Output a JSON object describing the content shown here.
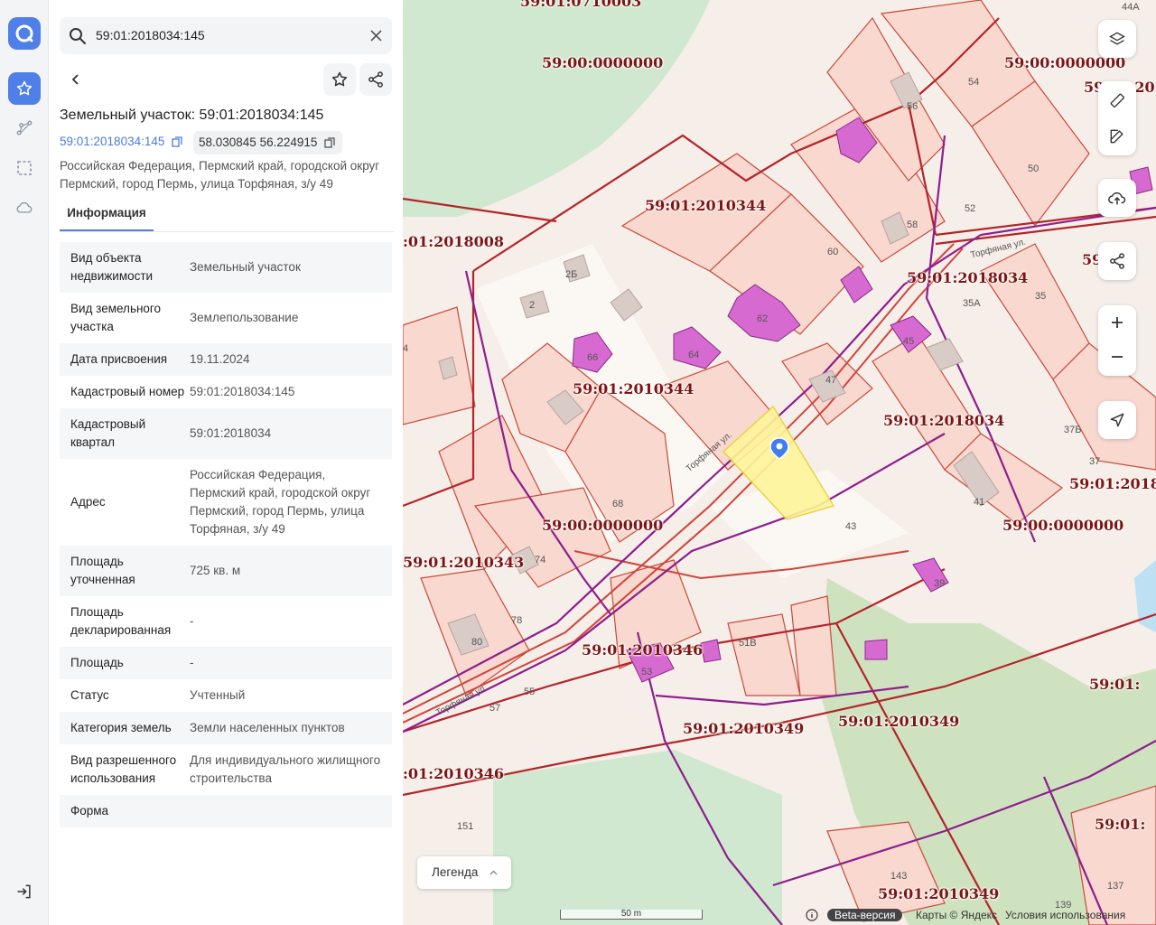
{
  "search": {
    "value": "59:01:2018034:145"
  },
  "parcel": {
    "title": "Земельный участок: 59:01:2018034:145",
    "cadastral_link": "59:01:2018034:145",
    "coords": "58.030845 56.224915",
    "address": "Российская Федерация, Пермский край, городской округ Пермский, город Пермь, улица Торфяная, з/у 49"
  },
  "tabs": {
    "info": "Информация"
  },
  "properties": [
    {
      "key": "Вид объекта недвижимости",
      "value": "Земельный участок"
    },
    {
      "key": "Вид земельного участка",
      "value": "Землепользование"
    },
    {
      "key": "Дата присвоения",
      "value": "19.11.2024"
    },
    {
      "key": "Кадастровый номер",
      "value": "59:01:2018034:145"
    },
    {
      "key": "Кадастровый квартал",
      "value": "59:01:2018034"
    },
    {
      "key": "Адрес",
      "value": "Российская Федерация, Пермский край, городской округ Пермский, город Пермь, улица Торфяная, з/у 49"
    },
    {
      "key": "Площадь уточненная",
      "value": "725 кв. м"
    },
    {
      "key": "Площадь декларированная",
      "value": "-"
    },
    {
      "key": "Площадь",
      "value": "-"
    },
    {
      "key": "Статус",
      "value": "Учтенный"
    },
    {
      "key": "Категория земель",
      "value": "Земли населенных пунктов"
    },
    {
      "key": "Вид разрешенного использования",
      "value": "Для индивидуального жилищного строительства"
    },
    {
      "key": "Форма",
      "value": ""
    }
  ],
  "map": {
    "quarter_labels": [
      "59:01:0710003",
      "59:00:0000000",
      "59:00:0000000",
      "59:01:2018",
      "59:01:2010344",
      ":01:2018008",
      "59:01:2018034",
      "59:01:2010344",
      "59:01:2018034",
      "59:01:2018",
      "59:00:0000000",
      "59:00:0000000",
      "59:01:2010343",
      "59:01:2010346",
      "59:01:",
      "59:01:2010349",
      "59:01:2010349",
      ":01:2010346",
      "59:01:",
      "59:01:2010349",
      "59:0"
    ],
    "house_numbers": [
      "44A",
      "56",
      "54",
      "50",
      "52",
      "58",
      "60",
      "2Б",
      "2",
      "62",
      "64",
      "66",
      "47",
      "45",
      "35A",
      "35",
      "37Б",
      "37",
      "41",
      "43",
      "68",
      "74",
      "78",
      "80",
      "51В",
      "53",
      "55",
      "57",
      "39",
      "151",
      "143",
      "139",
      "137",
      "4"
    ],
    "street_labels": [
      "Торфяная ул.",
      "Торфяная ул.",
      "Торфяная ул."
    ],
    "legend_label": "Легенда",
    "scale_label": "50 m",
    "beta_label": "Beta-версия",
    "copyright": "Карты © Яндекс",
    "terms": "Условия использования"
  },
  "colors": {
    "accent": "#4f7fe8",
    "parcel_fill": "#f8e9e2",
    "boundary": "#c94a3a",
    "highlight": "#fff59a",
    "building": "#d66ad0",
    "label": "#7c1515"
  }
}
